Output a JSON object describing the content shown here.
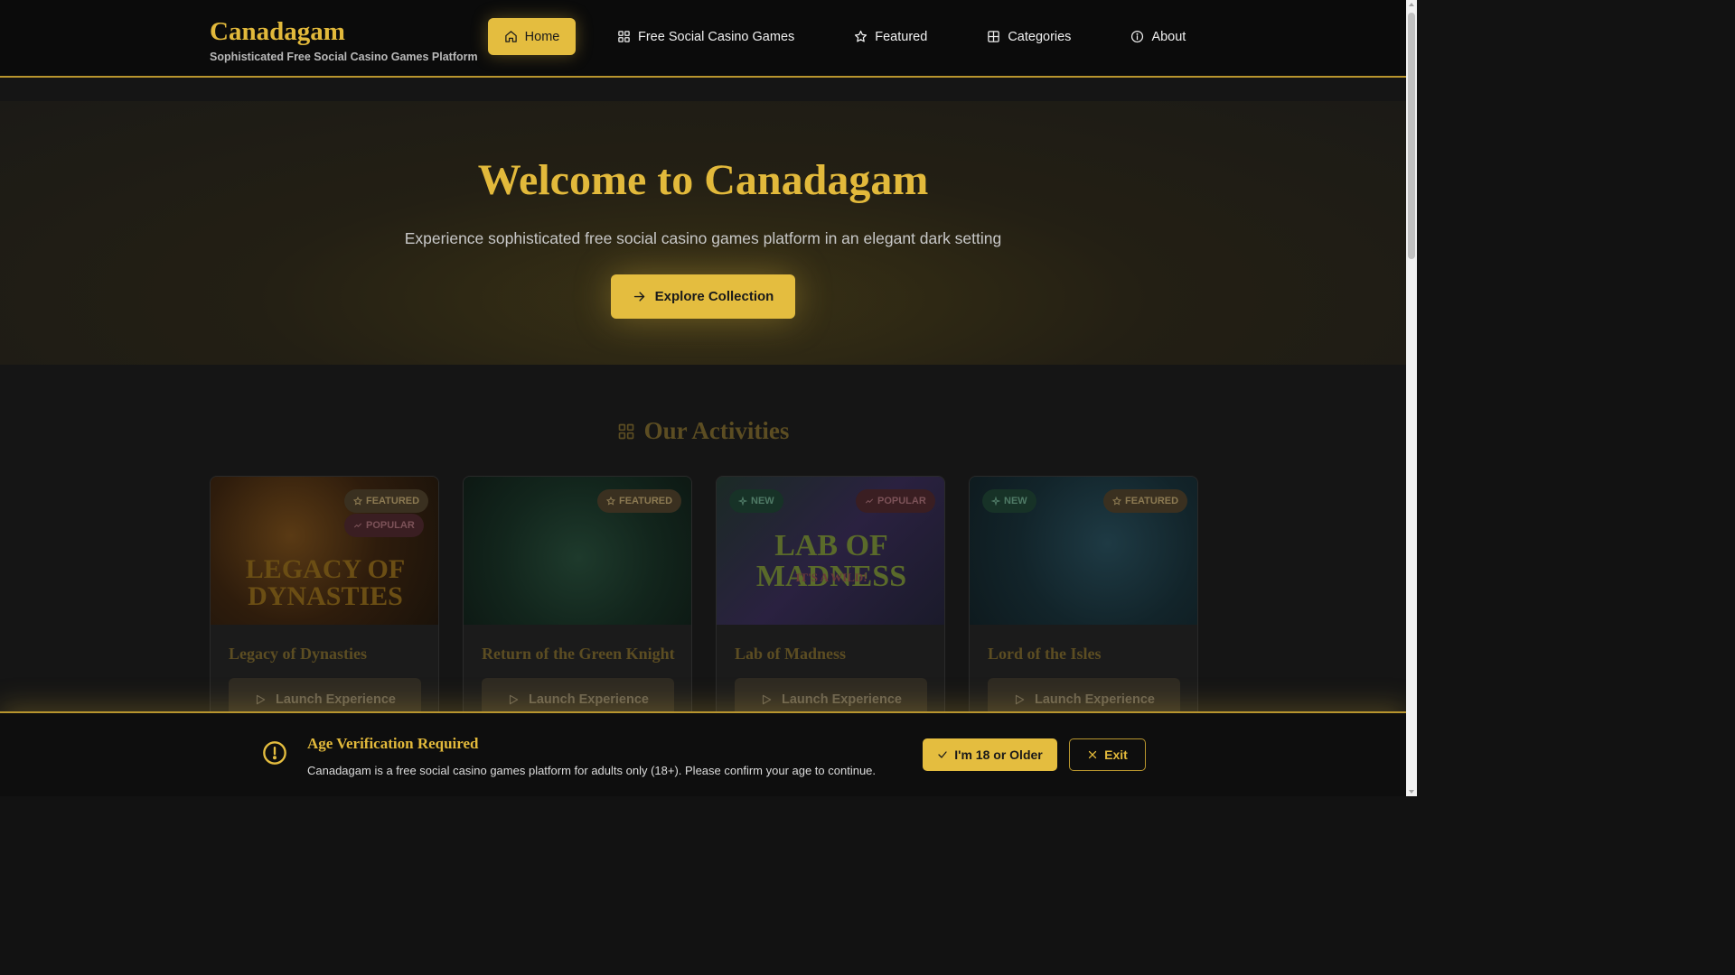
{
  "brand": {
    "title": "Canadagam",
    "subtitle": "Sophisticated Free Social Casino Games Platform"
  },
  "nav": {
    "home": "Home",
    "free_games": "Free Social Casino Games",
    "featured": "Featured",
    "categories": "Categories",
    "about": "About",
    "active": "Home"
  },
  "hero": {
    "title": "Welcome to Canadagam",
    "subtitle": "Experience sophisticated free social casino games platform in an elegant dark setting",
    "cta": "Explore Collection"
  },
  "activities": {
    "title": "Our Activities",
    "cards": [
      {
        "name": "Legacy of Dynasties",
        "image_text": "LEGACY OF DYNASTIES",
        "badges": [
          "FEATURED",
          "POPULAR"
        ],
        "button": "Launch Experience"
      },
      {
        "name": "Return of the Green Knight",
        "badges": [
          "FEATURED"
        ],
        "button": "Launch Experience"
      },
      {
        "name": "Lab of Madness",
        "image_text": "LAB OF MADNESS",
        "image_subtext": "IT'S A WILD!",
        "badges": [
          "NEW",
          "POPULAR"
        ],
        "button": "Launch Experience"
      },
      {
        "name": "Lord of the Isles",
        "badges": [
          "NEW",
          "FEATURED"
        ],
        "button": "Launch Experience"
      }
    ]
  },
  "age_verification": {
    "title": "Age Verification Required",
    "message": "Canadagam is a free social casino games platform for adults only (18+). Please confirm your age to continue.",
    "confirm": "I'm 18 or Older",
    "exit": "Exit"
  },
  "colors": {
    "accent": "#e4bd3f",
    "background": "#151515",
    "header": "#0b0b0b"
  }
}
